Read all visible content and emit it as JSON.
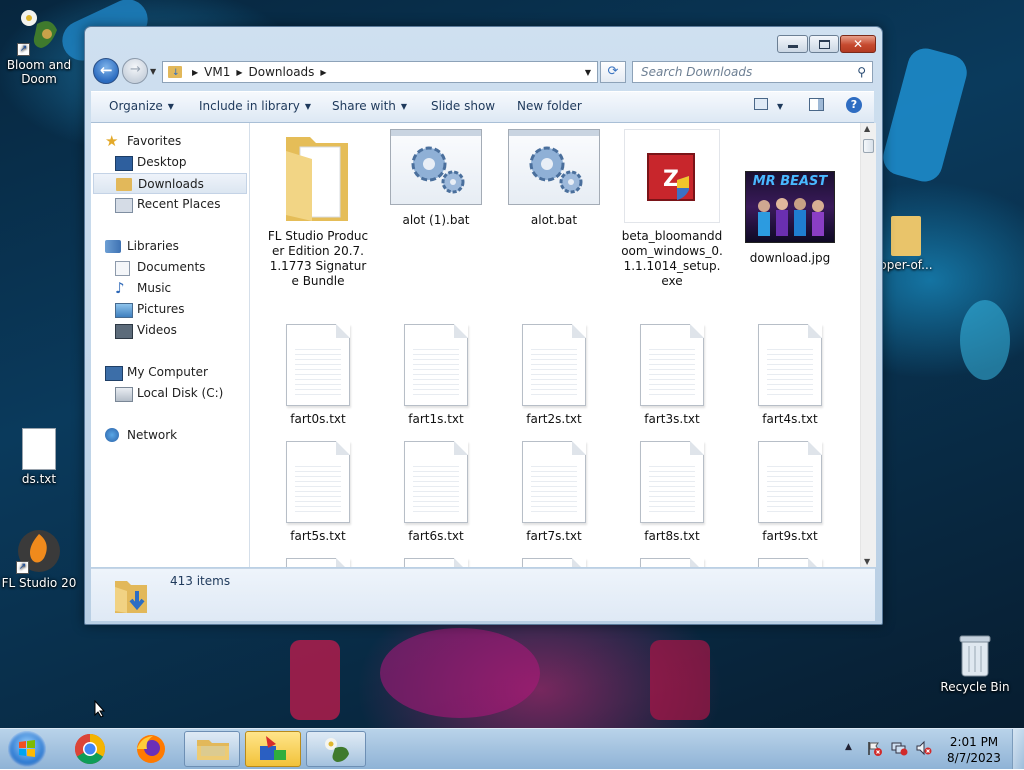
{
  "desktop": {
    "icons": [
      {
        "label": "Bloom and Doom",
        "icon": "flower-app-icon"
      },
      {
        "label": "ds.txt",
        "icon": "text-file-icon"
      },
      {
        "label": "FL Studio 20",
        "icon": "fl-studio-icon"
      },
      {
        "label": "Recycle Bin",
        "icon": "recycle-bin-icon"
      },
      {
        "label": "oper-of...",
        "icon": "folder-icon"
      }
    ]
  },
  "window": {
    "caption_buttons": {
      "minimize": "minimize-icon",
      "maximize": "maximize-icon",
      "close": "close-icon"
    },
    "address": {
      "crumbs": [
        "VM1",
        "Downloads"
      ]
    },
    "search": {
      "placeholder": "Search Downloads"
    },
    "toolbar": {
      "organize": "Organize",
      "include_in_library": "Include in library",
      "share_with": "Share with",
      "slide_show": "Slide show",
      "new_folder": "New folder"
    },
    "nav": {
      "favorites": "Favorites",
      "desktop": "Desktop",
      "downloads": "Downloads",
      "recent_places": "Recent Places",
      "libraries": "Libraries",
      "documents": "Documents",
      "music": "Music",
      "pictures": "Pictures",
      "videos": "Videos",
      "my_computer": "My Computer",
      "local_disk": "Local Disk (C:)",
      "network": "Network"
    },
    "files": {
      "row1": [
        {
          "name": "FL Studio Producer Edition 20.7.1.1773 Signature Bundle",
          "type": "folder"
        },
        {
          "name": "alot (1).bat",
          "type": "batch"
        },
        {
          "name": "alot.bat",
          "type": "batch"
        },
        {
          "name": "beta_bloomanddoom_windows_0.1.1.1014_setup.exe",
          "type": "exe"
        },
        {
          "name": "download.jpg",
          "type": "image"
        }
      ],
      "txt": [
        "fart0s.txt",
        "fart1s.txt",
        "fart2s.txt",
        "fart3s.txt",
        "fart4s.txt",
        "fart5s.txt",
        "fart6s.txt",
        "fart7s.txt",
        "fart8s.txt",
        "fart9s.txt"
      ],
      "image_text": "MR BEAST"
    },
    "status": {
      "item_count": "413 items"
    }
  },
  "taskbar": {
    "start": "windows-start-icon",
    "pinned": [
      "chrome-icon",
      "firefox-icon",
      "explorer-icon",
      "paint-icon",
      "bloom-and-doom-icon"
    ],
    "clock": {
      "time": "2:01 PM",
      "date": "8/7/2023"
    }
  },
  "colors": {
    "accent": "#2c6cc0",
    "taskbar": "#a6c4e0",
    "close": "#c64a2f"
  }
}
